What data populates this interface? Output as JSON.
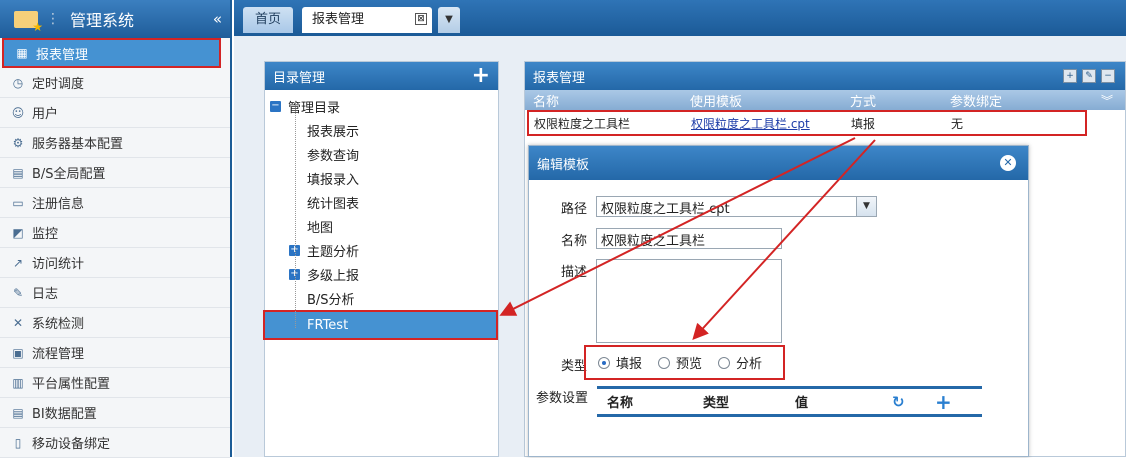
{
  "app": {
    "title": "管理系统",
    "collapse_icon": "«"
  },
  "sidebar": {
    "items": [
      {
        "label": "报表管理",
        "icon": "report-icon",
        "active": true
      },
      {
        "label": "定时调度",
        "icon": "clock-icon"
      },
      {
        "label": "用户",
        "icon": "user-icon"
      },
      {
        "label": "服务器基本配置",
        "icon": "gear-icon"
      },
      {
        "label": "B/S全局配置",
        "icon": "server-icon"
      },
      {
        "label": "注册信息",
        "icon": "register-icon"
      },
      {
        "label": "监控",
        "icon": "monitor-icon"
      },
      {
        "label": "访问统计",
        "icon": "chart-icon"
      },
      {
        "label": "日志",
        "icon": "log-icon"
      },
      {
        "label": "系统检测",
        "icon": "tools-icon"
      },
      {
        "label": "流程管理",
        "icon": "flow-icon"
      },
      {
        "label": "平台属性配置",
        "icon": "settings-icon"
      },
      {
        "label": "BI数据配置",
        "icon": "database-icon"
      },
      {
        "label": "移动设备绑定",
        "icon": "mobile-icon"
      }
    ]
  },
  "tabs": {
    "home": "首页",
    "report": "报表管理",
    "close": "⊠",
    "more": "▼"
  },
  "directory": {
    "title": "目录管理",
    "root": "管理目录",
    "nodes": [
      "报表展示",
      "参数查询",
      "填报录入",
      "统计图表",
      "地图"
    ],
    "groups": [
      "主题分析",
      "多级上报"
    ],
    "leaf1": "B/S分析",
    "selected": "FRTest"
  },
  "report_panel": {
    "title": "报表管理",
    "columns": [
      "名称",
      "使用模板",
      "方式",
      "参数绑定"
    ],
    "row": {
      "name": "权限粒度之工具栏",
      "template": "权限粒度之工具栏.cpt",
      "mode": "填报",
      "binding": "无"
    }
  },
  "dialog": {
    "title": "编辑模板",
    "path_label": "路径",
    "path_value": "权限粒度之工具栏.cpt",
    "name_label": "名称",
    "name_value": "权限粒度之工具栏",
    "desc_label": "描述",
    "type_label": "类型",
    "types": [
      "填报",
      "预览",
      "分析"
    ],
    "param_label": "参数设置",
    "param_cols": [
      "名称",
      "类型",
      "值"
    ]
  }
}
